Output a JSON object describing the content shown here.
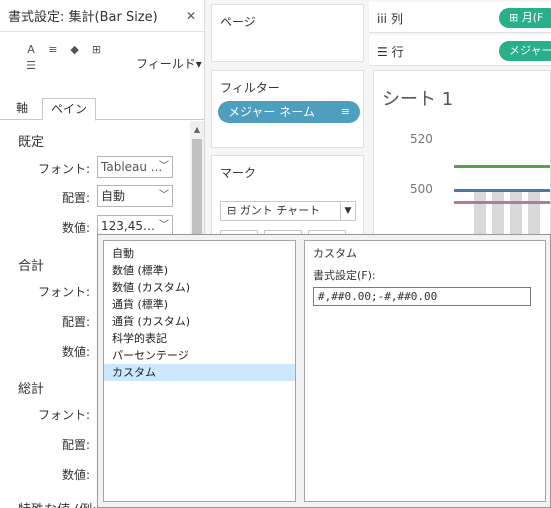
{
  "format_pane": {
    "title": "書式設定: 集計(Bar Size)",
    "close_glyph": "✕",
    "field_dropdown": "フィールド▾",
    "tabs": {
      "axis": "軸",
      "pane": "ペイン"
    },
    "sections": {
      "default": {
        "title": "既定",
        "font_label": "フォント:",
        "font_value": "Tableau ...",
        "align_label": "配置:",
        "align_value": "自動",
        "number_label": "数値:",
        "number_value": "123,45…"
      },
      "total": {
        "title": "合計",
        "font_label": "フォント:",
        "align_label": "配置:",
        "number_label": "数値:"
      },
      "grand_total": {
        "title": "総計",
        "font_label": "フォント:",
        "align_label": "配置:",
        "number_label": "数値:"
      },
      "special_values": {
        "title": "特殊な値 (例: NULL)"
      }
    }
  },
  "cards": {
    "pages": {
      "title": "ページ"
    },
    "filters": {
      "title": "フィルター",
      "pill": "メジャー ネーム"
    },
    "marks": {
      "title": "マーク",
      "type": "ガント チャート"
    }
  },
  "view": {
    "columns_shelf": {
      "label": "列",
      "pill": "月(F"
    },
    "rows_shelf": {
      "label": "行",
      "pill": "メジャー"
    },
    "sheet_title": "シート 1",
    "y_ticks": [
      "520",
      "500"
    ]
  },
  "chart_data": {
    "type": "bar",
    "yticks": [
      520,
      500
    ],
    "reference_lines": [
      {
        "value": 510,
        "color": "#59a14f"
      },
      {
        "value": 500,
        "color": "#4e79a7"
      },
      {
        "value": 495,
        "color": "#b07aa1"
      }
    ]
  },
  "number_format_popup": {
    "items": [
      "自動",
      "数値 (標準)",
      "数値 (カスタム)",
      "通貨 (標準)",
      "通貨 (カスタム)",
      "科学的表記",
      "パーセンテージ",
      "カスタム"
    ],
    "selected_index": 7,
    "custom_legend": "カスタム",
    "format_label": "書式設定(F):",
    "format_value": "#,##0.00;-#,##0.00"
  }
}
